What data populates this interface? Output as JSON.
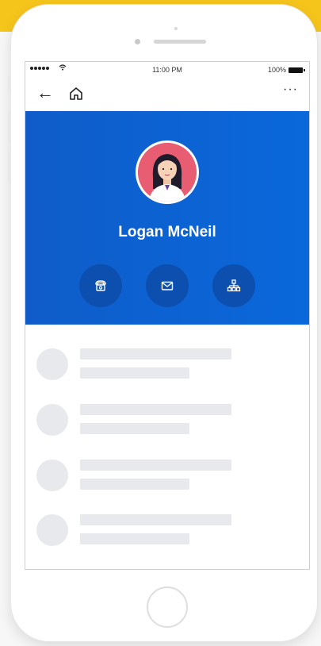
{
  "status_bar": {
    "wifi_icon": "wifi-icon",
    "time": "11:00 PM",
    "battery": "100%"
  },
  "nav": {
    "back_icon": "back-arrow-icon",
    "home_icon": "home-icon",
    "more_label": "···"
  },
  "profile": {
    "name": "Logan McNeil",
    "avatar_bg": "#e85d72",
    "header_color": "#0a62d4",
    "actions": [
      {
        "icon": "phone-icon"
      },
      {
        "icon": "mail-icon"
      },
      {
        "icon": "org-chart-icon"
      }
    ]
  },
  "list": {
    "placeholder_rows": 4
  }
}
